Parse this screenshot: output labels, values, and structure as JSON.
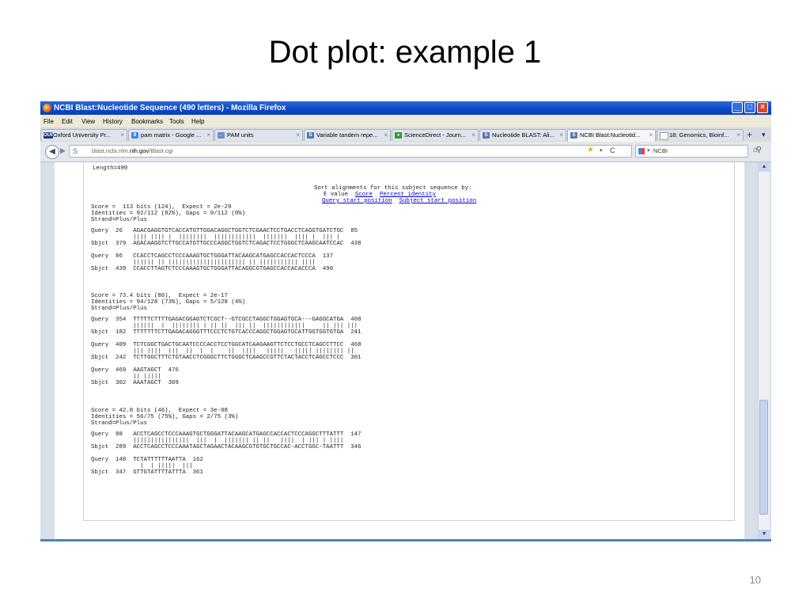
{
  "slide": {
    "title": "Dot plot: example 1",
    "page_number": "10"
  },
  "window": {
    "title": "NCBI Blast:Nucleotide Sequence (490 letters) - Mozilla Firefox"
  },
  "menu": [
    "File",
    "Edit",
    "View",
    "History",
    "Bookmarks",
    "Tools",
    "Help"
  ],
  "tabs": [
    {
      "icon": "OUP",
      "label": "Oxford University Pr...",
      "color": "#1f3a7a"
    },
    {
      "icon": "8",
      "label": "pam matrix - Google ...",
      "color": "#4285f4"
    },
    {
      "icon": "←",
      "label": "PAM units",
      "color": "#6a8fc4"
    },
    {
      "icon": "S",
      "label": "Variable tandem repe...",
      "color": "#5a78b0"
    },
    {
      "icon": "●",
      "label": "ScienceDirect - Journ...",
      "color": "#2e9a3a"
    },
    {
      "icon": "S",
      "label": "Nucleotide BLAST: Ali...",
      "color": "#5a78b0"
    },
    {
      "icon": "S",
      "label": "NCBI Blast:Nucleotid...",
      "color": "#5a78b0"
    },
    {
      "icon": "",
      "label": "18: Genomics, Bioinf...",
      "color": "#cccccc"
    }
  ],
  "nav": {
    "url_prefix": "blast.ncbi.nlm.",
    "url_domain": "nih.gov",
    "url_path": "/Blast.cgi",
    "search_text": "NCBI"
  },
  "blast": {
    "length_line": "Length=490",
    "sort_header": "Sort alignments for this subject sequence by:",
    "sort_row1_prefix": "E value",
    "sort_links_row1": [
      "Score",
      "Percent identity"
    ],
    "sort_links_row2": [
      "Query start position",
      "Subject start position"
    ],
    "hsp1": {
      "lines": [
        "Score =  113 bits (124),  Expect = 2e-29",
        "Identities = 92/112 (82%), Gaps = 0/112 (0%)",
        "Strand=Plus/Plus",
        "",
        "Query  26   AGACGAGGTGTCACCATGTTGGACAGGCTGGTCTCGAACTCCTGACCTCAGGTGATCTGC  85",
        "            |||| |||| |  ||||||||  ||||||||||||  |||||||  |||| |  ||| |",
        "Sbjct  379  AGACAAGGTCTTGCCATGTTGCCCAGGCTGGTCTCAGACTCCTGGGCTCAAGCAATCCAC  438",
        "",
        "Query  86   CCACCTCAGCCTCCCAAAGTGCTGGGATTACAAGCATGAGCCACCACTCCCA  137",
        "            |||||| || |||||||||||||||||||||| || ||||||||||| ||||",
        "Sbjct  439  CCACCTTAGTCTCCCAAAGTGCTGGGATTACAGGCGTGAGCCACCACACCCA  490"
      ]
    },
    "hsp2": {
      "lines": [
        "Score = 73.4 bits (80),  Expect = 2e-17",
        "Identities = 94/128 (73%), Gaps = 5/128 (4%)",
        "Strand=Plus/Plus",
        "",
        "Query  354  TTTTTCTTTTGAGACGGAGTCTCGCT--GTCGCCTAGGCTGGAGTGCA---GAGGCATGA  408",
        "            ||||||  |  |||||||| | || ||  ||| ||  ||||||||||||     || ||| |||",
        "Sbjct  182  TTTTTTTCTTGAGACAGGGTTTCCCTCTGTCACCCAGGCTGGAGTGCATTGGTGGTGTGA  241",
        "",
        "Query  409  TCTCGGCTGACTGCAATCCCCACCTCCTGGCATCAAGAAGTTCTCCTGCCTCAGCCTTCC  468",
        "            ||| ||||  |||  ||  |  |    ||  ||||   |||||   ||||| |||||||| ||",
        "Sbjct  242  TCTTGGCTTTCTGTAACCTCGGGCTTCTGGGCTCAAGCCGTTCTACTACCTCAGCCTCCC  301",
        "",
        "Query  469  AAGTAGCT  476",
        "            || |||||",
        "Sbjct  302  AAATAGCT  309"
      ]
    },
    "hsp3": {
      "lines": [
        "Score = 42.8 bits (46),  Expect = 3e-08",
        "Identities = 56/75 (75%), Gaps = 2/75 (3%)",
        "Strand=Plus/Plus",
        "",
        "Query  88   ACCTCAGCCTCCCAAAGTGCTGGGATTACAAGCATGAGCCACCACTCCCAGGCTTTATTT  147",
        "            ||||||||||||||||  |||  |  ||||||| || ||   ||||  | ||| | ||||",
        "Sbjct  289  ACCTCAGCCTCCCAAATAGCTAGAACTACAAGCGTGTGCTGCCAC-ACCTGGC-TAATTT  346",
        "",
        "Query  148  TCTATTTTTTAATTA  162",
        "              |  | |||||  |||",
        "Sbjct  347  GTTGTATTTTATTTA  361"
      ]
    }
  }
}
